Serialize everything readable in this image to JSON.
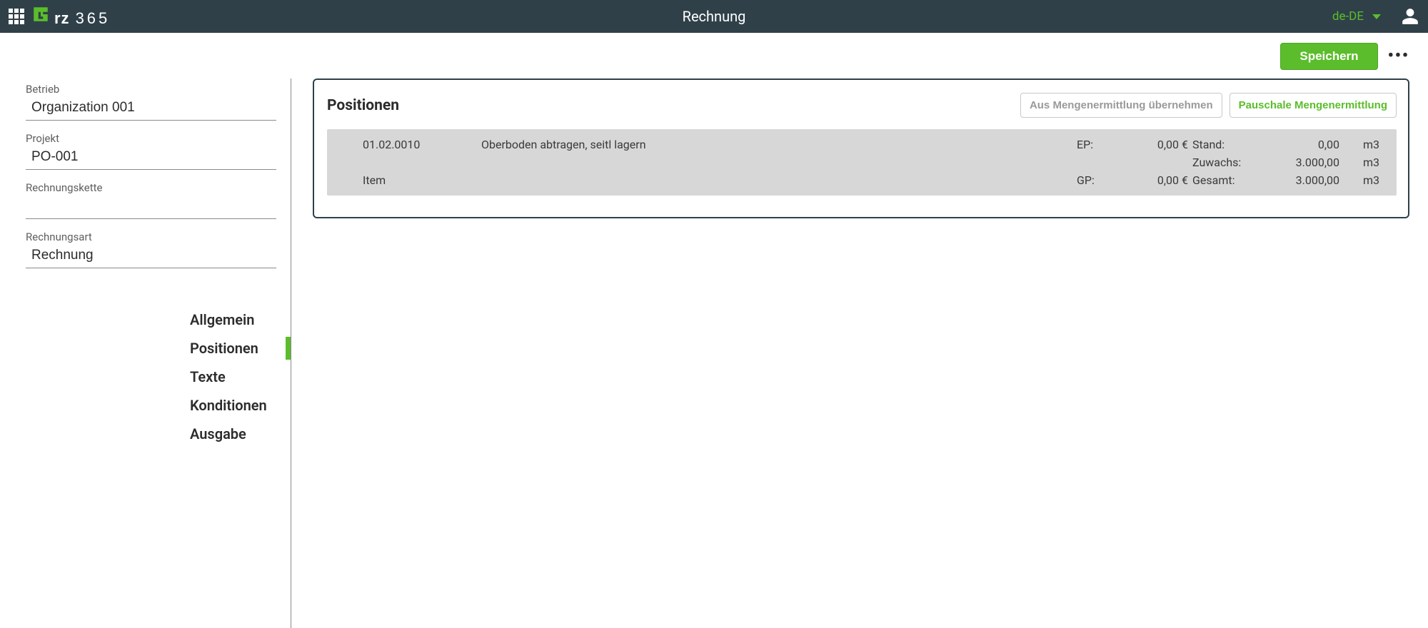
{
  "header": {
    "title": "Rechnung",
    "locale": "de-DE"
  },
  "toolbar": {
    "save_label": "Speichern"
  },
  "sidebar": {
    "fields": {
      "betrieb": {
        "label": "Betrieb",
        "value": "Organization 001"
      },
      "projekt": {
        "label": "Projekt",
        "value": "PO-001"
      },
      "rechnungskette": {
        "label": "Rechnungskette",
        "value": ""
      },
      "rechnungsart": {
        "label": "Rechnungsart",
        "value": "Rechnung"
      }
    },
    "tabs": [
      {
        "label": "Allgemein"
      },
      {
        "label": "Positionen"
      },
      {
        "label": "Texte"
      },
      {
        "label": "Konditionen"
      },
      {
        "label": "Ausgabe"
      }
    ]
  },
  "panel": {
    "title": "Positionen",
    "btn_from_qty": "Aus Mengenermittlung übernehmen",
    "btn_pauschal": "Pauschale Mengenermittlung",
    "row": {
      "code": "01.02.0010",
      "description": "Oberboden abtragen, seitl lagern",
      "item_label": "Item",
      "ep_label": "EP:",
      "ep_value": "0,00 €",
      "gp_label": "GP:",
      "gp_value": "0,00 €",
      "stand_label": "Stand:",
      "stand_value": "0,00",
      "zuwachs_label": "Zuwachs:",
      "zuwachs_value": "3.000,00",
      "gesamt_label": "Gesamt:",
      "gesamt_value": "3.000,00",
      "unit": "m3"
    }
  }
}
